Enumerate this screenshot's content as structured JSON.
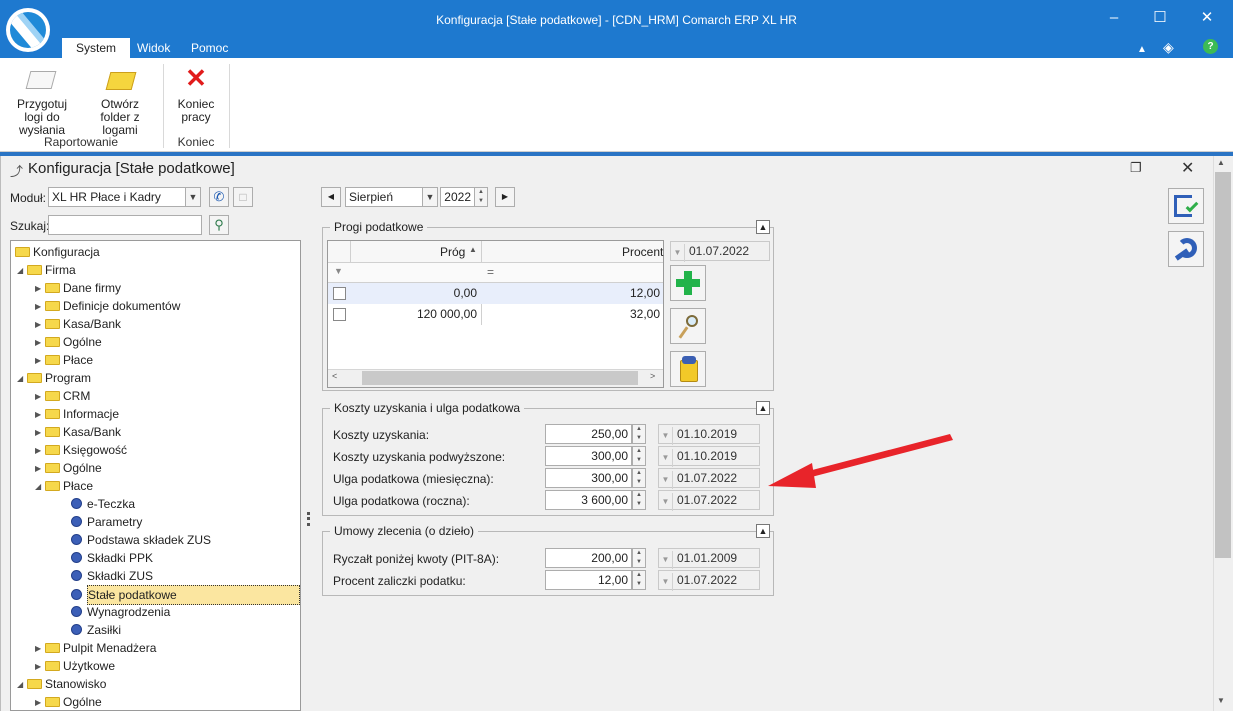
{
  "window": {
    "title": "Konfiguracja [Stałe podatkowe] - [CDN_HRM] Comarch ERP XL HR"
  },
  "ribbon": {
    "tabs": [
      "System",
      "Widok",
      "Pomoc"
    ],
    "buttons": {
      "prepare_logs": "Przygotuj logi do wysłania",
      "open_folder": "Otwórz folder z logami",
      "end_work": "Koniec pracy"
    },
    "groups": {
      "reporting": "Raportowanie",
      "end": "Koniec"
    }
  },
  "config_window": {
    "title": "Konfiguracja [Stałe podatkowe]"
  },
  "filters": {
    "module_label": "Moduł:",
    "module_value": "XL HR Płace i Kadry",
    "search_label": "Szukaj:",
    "search_value": ""
  },
  "tree": {
    "root": "Konfiguracja",
    "firma": "Firma",
    "firma_items": [
      "Dane firmy",
      "Definicje dokumentów",
      "Kasa/Bank",
      "Ogólne",
      "Płace"
    ],
    "program": "Program",
    "program_items": [
      "CRM",
      "Informacje",
      "Kasa/Bank",
      "Księgowość",
      "Ogólne"
    ],
    "place": "Płace",
    "place_items": [
      "e-Teczka",
      "Parametry",
      "Podstawa składek ZUS",
      "Składki PPK",
      "Składki ZUS",
      "Stałe podatkowe",
      "Wynagrodzenia",
      "Zasiłki"
    ],
    "program_items_after": [
      "Pulpit Menadżera",
      "Użytkowe"
    ],
    "stanowisko": "Stanowisko",
    "stanowisko_items": [
      "Ogólne"
    ]
  },
  "period": {
    "month": "Sierpień",
    "year": "2022"
  },
  "tax_thresholds": {
    "title": "Progi podatkowe",
    "columns": [
      "Próg",
      "Procent"
    ],
    "filter_symbol": "=",
    "rows": [
      {
        "prog": "0,00",
        "procent": "12,00"
      },
      {
        "prog": "120 000,00",
        "procent": "32,00"
      }
    ],
    "date": "01.07.2022"
  },
  "costs": {
    "title": "Koszty uzyskania i ulga podatkowa",
    "rows": [
      {
        "label": "Koszty uzyskania:",
        "value": "250,00",
        "date": "01.10.2019"
      },
      {
        "label": "Koszty uzyskania podwyższone:",
        "value": "300,00",
        "date": "01.10.2019"
      },
      {
        "label": "Ulga podatkowa (miesięczna):",
        "value": "300,00",
        "date": "01.07.2022"
      },
      {
        "label": "Ulga podatkowa (roczna):",
        "value": "3 600,00",
        "date": "01.07.2022"
      }
    ]
  },
  "contracts": {
    "title": "Umowy zlecenia (o dzieło)",
    "rows": [
      {
        "label": "Ryczałt poniżej kwoty (PIT-8A):",
        "value": "200,00",
        "date": "01.01.2009"
      },
      {
        "label": "Procent zaliczki podatku:",
        "value": "12,00",
        "date": "01.07.2022"
      }
    ]
  },
  "colors": {
    "titlebar": "#1e79cf",
    "selection": "#fbe6a0",
    "arrow": "#e8242a"
  },
  "icons": [
    "app-logo-icon",
    "minimize-icon",
    "maximize-icon",
    "close-icon",
    "save-icon",
    "pin-icon",
    "add-icon",
    "edit-icon",
    "delete-icon"
  ]
}
